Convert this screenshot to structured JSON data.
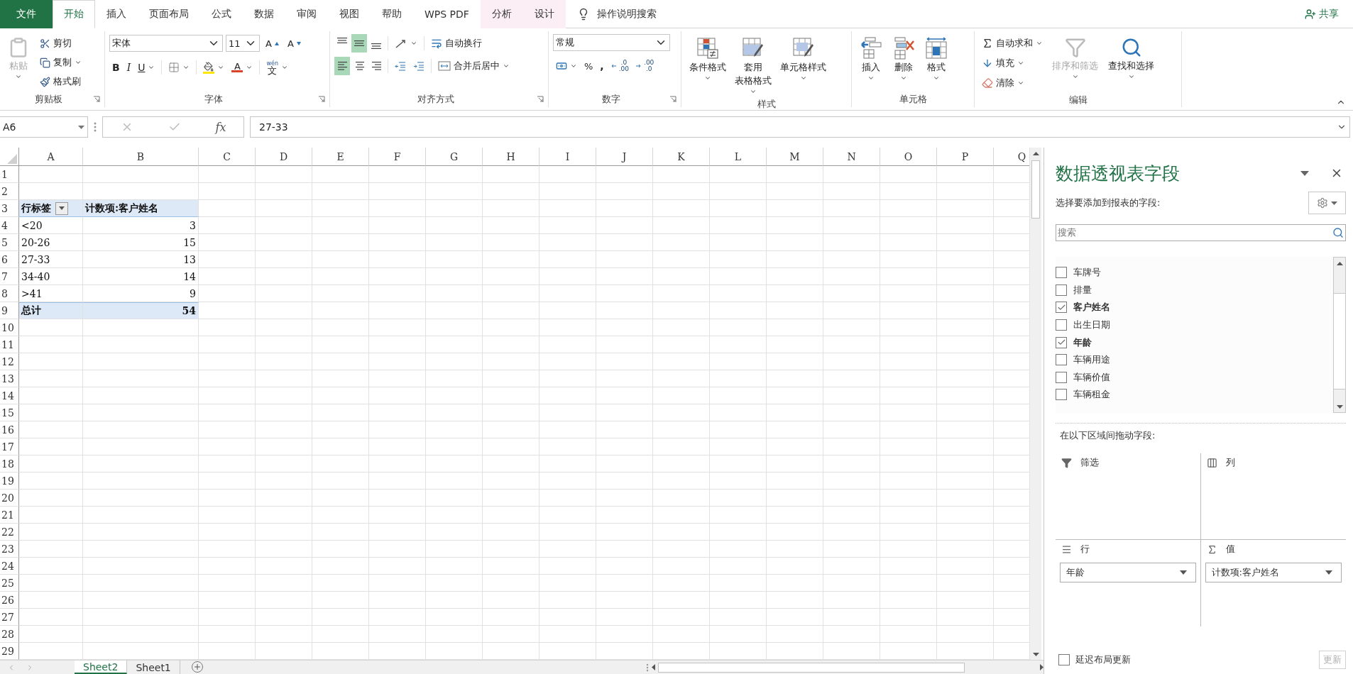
{
  "tabs": [
    {
      "label": "文件",
      "kind": "file",
      "selected": false
    },
    {
      "label": "开始",
      "kind": "normal",
      "selected": true
    },
    {
      "label": "插入",
      "kind": "normal",
      "selected": false
    },
    {
      "label": "页面布局",
      "kind": "normal",
      "selected": false
    },
    {
      "label": "公式",
      "kind": "normal",
      "selected": false
    },
    {
      "label": "数据",
      "kind": "normal",
      "selected": false
    },
    {
      "label": "审阅",
      "kind": "normal",
      "selected": false
    },
    {
      "label": "视图",
      "kind": "normal",
      "selected": false
    },
    {
      "label": "帮助",
      "kind": "normal",
      "selected": false
    },
    {
      "label": "WPS PDF",
      "kind": "normal",
      "selected": false
    },
    {
      "label": "分析",
      "kind": "contextual",
      "selected": false
    },
    {
      "label": "设计",
      "kind": "contextual",
      "selected": false
    }
  ],
  "tell_me": "操作说明搜索",
  "share": "共享",
  "clipboard": {
    "title": "剪贴板",
    "paste": {
      "label": "粘贴",
      "disabled": true
    },
    "items": [
      {
        "kind": "cut",
        "label": "剪切",
        "dropdown": false
      },
      {
        "kind": "copy",
        "label": "复制",
        "dropdown": true
      },
      {
        "kind": "painter",
        "label": "格式刷",
        "dropdown": false
      }
    ]
  },
  "font": {
    "title": "字体",
    "name": "宋体",
    "size": "11",
    "grow": "A",
    "shrink": "A",
    "styles": [
      {
        "kind": "bold",
        "label": "B"
      },
      {
        "kind": "italic",
        "label": "I"
      },
      {
        "kind": "underline",
        "label": "U"
      }
    ],
    "font_color": "A",
    "phonetic": {
      "ruby": "wén",
      "char": "文"
    }
  },
  "alignment": {
    "title": "对齐方式",
    "buttons": [
      {
        "kind": "top",
        "selected": false
      },
      {
        "kind": "middle",
        "selected": true
      },
      {
        "kind": "bottom",
        "selected": false
      },
      {
        "kind": "left",
        "selected": true
      },
      {
        "kind": "center",
        "selected": false
      },
      {
        "kind": "right",
        "selected": false
      }
    ],
    "wrap": "自动换行",
    "merge": "合并后居中"
  },
  "number": {
    "title": "数字",
    "format": "常规",
    "percent": "%",
    "comma": ",",
    "decimals": [
      {
        "kind": "increase",
        "top": ".0",
        "bottom": ".00"
      },
      {
        "kind": "decrease",
        "top": ".00",
        "bottom": ".0"
      }
    ]
  },
  "styles": {
    "title": "样式",
    "items": [
      {
        "kind": "conditional",
        "lines": [
          "条件格式"
        ]
      },
      {
        "kind": "table",
        "lines": [
          "套用",
          "表格格式"
        ]
      },
      {
        "kind": "cell",
        "lines": [
          "单元格样式"
        ]
      }
    ]
  },
  "cells": {
    "title": "单元格",
    "items": [
      {
        "kind": "insert",
        "label": "插入"
      },
      {
        "kind": "delete",
        "label": "删除"
      },
      {
        "kind": "format",
        "label": "格式"
      }
    ]
  },
  "editing": {
    "title": "编辑",
    "items": [
      {
        "kind": "autosum",
        "label": "自动求和"
      },
      {
        "kind": "fill",
        "label": "填充"
      },
      {
        "kind": "clear",
        "label": "清除"
      }
    ],
    "big": [
      {
        "kind": "sort",
        "label": "排序和筛选",
        "disabled": true
      },
      {
        "kind": "find",
        "label": "查找和选择",
        "disabled": false
      }
    ]
  },
  "formula_bar": {
    "name_box": "A6",
    "fx": "fx",
    "value": "27-33"
  },
  "sheet": {
    "columns": [
      "A",
      "B",
      "C",
      "D",
      "E",
      "F",
      "G",
      "H",
      "I",
      "J",
      "K",
      "L",
      "M",
      "N",
      "O",
      "P",
      "Q"
    ],
    "row_numbers": [
      "1",
      "2",
      "3",
      "4",
      "5",
      "6",
      "7",
      "8",
      "9",
      "10",
      "11",
      "12",
      "13",
      "14",
      "15",
      "16",
      "17",
      "18",
      "19",
      "20",
      "21",
      "22",
      "23",
      "24",
      "25",
      "26",
      "27",
      "28",
      "29"
    ],
    "pivot": {
      "header": [
        "行标签",
        "计数项:客户姓名"
      ],
      "rows": [
        [
          "<20",
          "3"
        ],
        [
          "20-26",
          "15"
        ],
        [
          "27-33",
          "13"
        ],
        [
          "34-40",
          "14"
        ],
        [
          ">41",
          "9"
        ]
      ],
      "total": [
        "总计",
        "54"
      ]
    }
  },
  "sheet_tabs": [
    {
      "label": "Sheet2",
      "selected": true
    },
    {
      "label": "Sheet1",
      "selected": false
    }
  ],
  "pivot_panel": {
    "title": "数据透视表字段",
    "subtitle": "选择要添加到报表的字段:",
    "search_placeholder": "搜索",
    "fields": [
      {
        "label": "车牌号",
        "checked": false
      },
      {
        "label": "排量",
        "checked": false
      },
      {
        "label": "客户姓名",
        "checked": true
      },
      {
        "label": "出生日期",
        "checked": false
      },
      {
        "label": "年龄",
        "checked": true
      },
      {
        "label": "车辆用途",
        "checked": false
      },
      {
        "label": "车辆价值",
        "checked": false
      },
      {
        "label": "车辆租金",
        "checked": false
      }
    ],
    "areas_label": "在以下区域间拖动字段:",
    "areas": [
      {
        "kind": "filter",
        "label": "筛选"
      },
      {
        "kind": "columns",
        "label": "列"
      },
      {
        "kind": "rows",
        "label": "行",
        "items": [
          "年龄"
        ]
      },
      {
        "kind": "values",
        "label": "值",
        "items": [
          "计数项:客户姓名"
        ]
      }
    ],
    "defer": {
      "label": "延迟布局更新",
      "checked": false
    },
    "update": {
      "label": "更新",
      "disabled": true
    }
  }
}
